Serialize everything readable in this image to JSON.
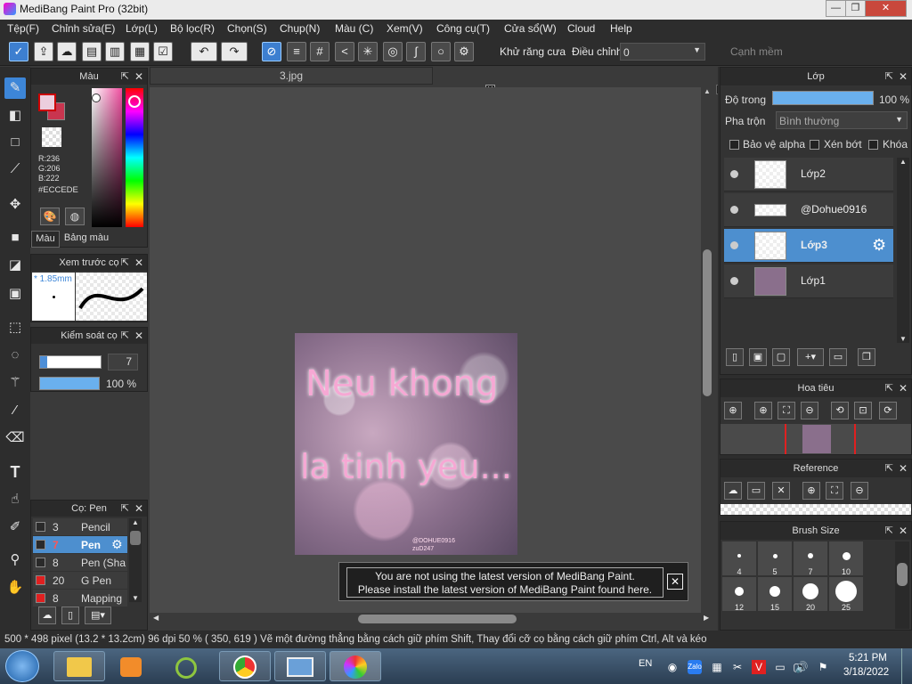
{
  "window": {
    "title": "MediBang Paint Pro (32bit)",
    "minimize": "—",
    "restore": "❐",
    "close": "✕"
  },
  "menu": [
    "Tệp(F)",
    "Chỉnh sửa(E)",
    "Lớp(L)",
    "Bộ lọc(R)",
    "Chọn(S)",
    "Chụp(N)",
    "Màu (C)",
    "Xem(V)",
    "Công cụ(T)",
    "Cửa sổ(W)",
    "Cloud",
    "Help"
  ],
  "toolbar": {
    "antialias_label": "Khử răng cưa",
    "antialias_checked": "✕",
    "correction_label": "Điều chỉnh",
    "correction_value": "0",
    "soft_edge_label": "Cạnh mềm"
  },
  "document_tab": "3.jpg",
  "color_panel": {
    "title": "Màu",
    "r": "R:236",
    "g": "G:206",
    "b": "B:222",
    "hex": "#ECCEDE",
    "tab_color": "Màu",
    "tab_palette": "Bảng màu",
    "primary_color": "#ECCEDE",
    "secondary_color": "#C9354F"
  },
  "brush_preview": {
    "title": "Xem trước cọ",
    "size": "* 1.85mm"
  },
  "brush_control": {
    "title": "Kiểm soát cọ",
    "size_value": "7",
    "opacity_value": "100 %",
    "opacity_fraction": 1.0
  },
  "brush_list": {
    "title": "Cọ: Pen",
    "items": [
      {
        "size": "3",
        "name": "Pencil",
        "color": "#2a2a2a"
      },
      {
        "size": "7",
        "name": "Pen",
        "color": "#2a2a2a"
      },
      {
        "size": "8",
        "name": "Pen (Sha",
        "color": "#2a2a2a"
      },
      {
        "size": "20",
        "name": "G Pen",
        "color": "#e02020"
      },
      {
        "size": "8",
        "name": "Mapping",
        "color": "#e02020"
      }
    ]
  },
  "artwork": {
    "line1": "Neu khong",
    "line2": "la tinh yeu...",
    "credit1": "@DOHUE0916",
    "credit2": "zuD247"
  },
  "notice": {
    "line1": "You are not using the latest version of MediBang Paint.",
    "line2": "Please install the latest version of MediBang Paint found here."
  },
  "layer_panel": {
    "title": "Lớp",
    "opacity_label": "Độ trong",
    "opacity_value": "100 %",
    "opacity_fraction": 1.0,
    "blend_label": "Pha trộn",
    "blend_value": "Bình thường",
    "protect_alpha": "Bảo vệ alpha",
    "clipping": "Xén bớt",
    "lock": "Khóa",
    "layers": [
      "Lớp2",
      "@Dohue0916",
      "Lớp3",
      "Lớp1"
    ]
  },
  "navigator": {
    "title": "Hoa tiêu"
  },
  "reference": {
    "title": "Reference"
  },
  "brush_size": {
    "title": "Brush Size",
    "sizes": [
      "4",
      "5",
      "7",
      "10",
      "12",
      "15",
      "20",
      "25"
    ]
  },
  "status": "500 * 498 pixel  (13.2 * 13.2cm)  96 dpi  50 %  ( 350, 619 )  Vẽ một đường thẳng bằng cách giữ phím Shift, Thay đổi cỡ cọ bằng cách giữ phím Ctrl, Alt và kéo",
  "taskbar": {
    "language": "EN",
    "time": "5:21 PM",
    "date": "3/18/2022"
  }
}
